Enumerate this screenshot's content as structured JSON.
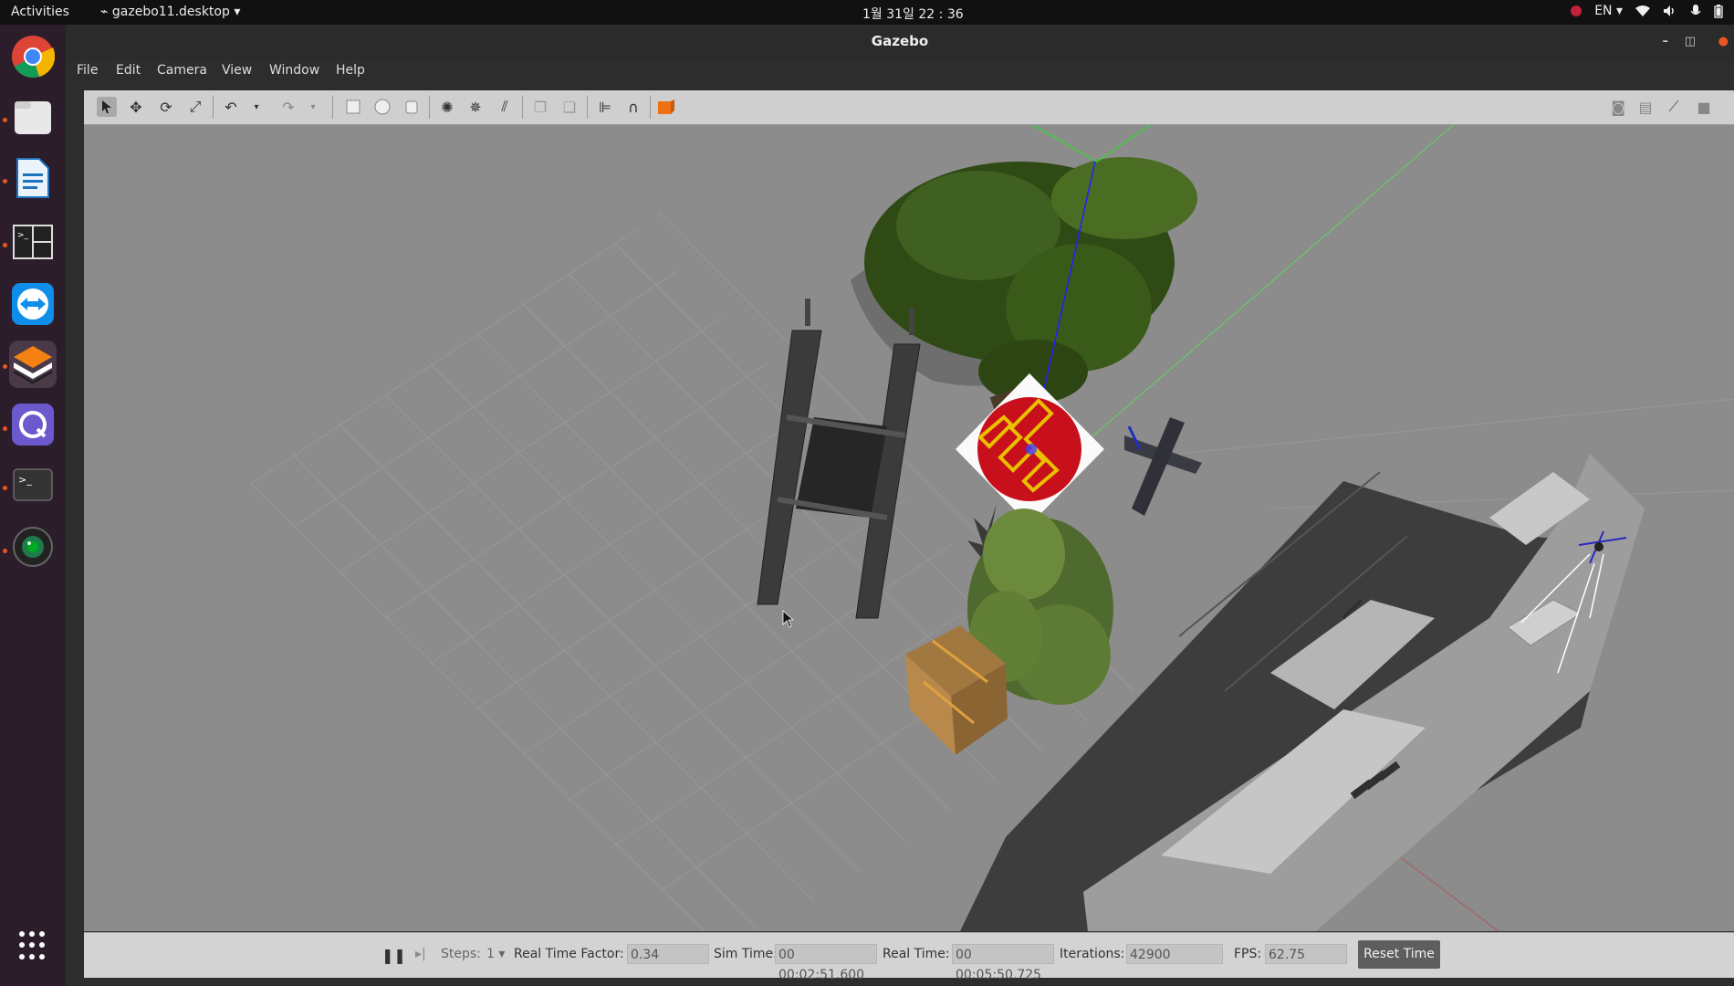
{
  "topbar": {
    "activities": "Activities",
    "app_menu": "gazebo11.desktop",
    "clock": "1월 31일 22 : 36",
    "language": "EN"
  },
  "window": {
    "title": "Gazebo"
  },
  "menu": {
    "file": "File",
    "edit": "Edit",
    "camera": "Camera",
    "view": "View",
    "window": "Window",
    "help": "Help"
  },
  "status": {
    "steps_label": "Steps:",
    "steps_value": "1",
    "rtf_label": "Real Time Factor:",
    "rtf_value": "0.34",
    "sim_label": "Sim Time:",
    "sim_value": "00 00:02:51.600",
    "real_label": "Real Time:",
    "real_value": "00 00:05:50.725",
    "iter_label": "Iterations:",
    "iter_value": "42900",
    "fps_label": "FPS:",
    "fps_value": "62.75",
    "reset_label": "Reset Time"
  },
  "colors": {
    "dock_bg": "#2c1d2b",
    "ground": "#8c8c8c",
    "helipad_red": "#c8101c",
    "helipad_yellow": "#e8c000"
  }
}
